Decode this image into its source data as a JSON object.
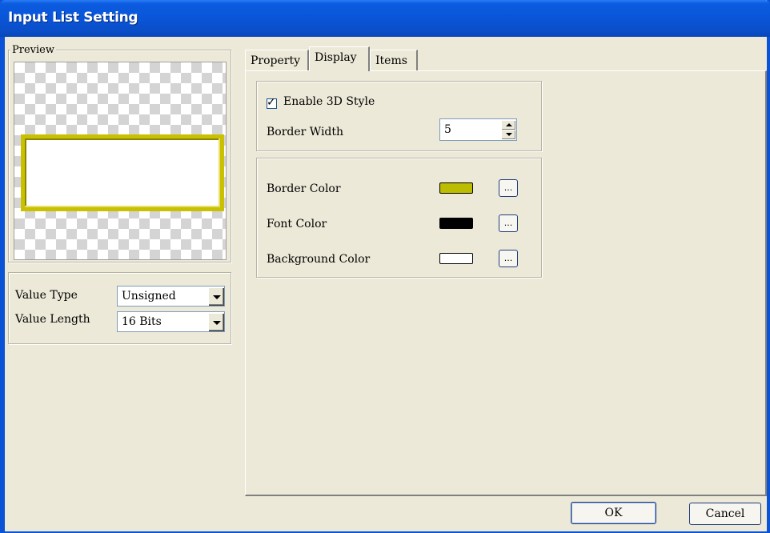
{
  "window": {
    "title": "Input List Setting"
  },
  "preview": {
    "legend": "Preview"
  },
  "value_settings": {
    "type_label": "Value Type",
    "type_value": "Unsigned",
    "length_label": "Value Length",
    "length_value": "16 Bits"
  },
  "tabs": [
    {
      "label": "Property"
    },
    {
      "label": "Display"
    },
    {
      "label": "Items"
    }
  ],
  "display": {
    "enable_3d_label": "Enable 3D Style",
    "enable_3d_checked": true,
    "border_width_label": "Border Width",
    "border_width_value": "5",
    "border_color_label": "Border Color",
    "font_color_label": "Font Color",
    "background_color_label": "Background Color",
    "picker_label": "...",
    "colors": {
      "border": "#bcbc00",
      "font": "#000000",
      "background": "#ffffff"
    }
  },
  "footer": {
    "ok_label": "OK",
    "cancel_label": "Cancel"
  }
}
